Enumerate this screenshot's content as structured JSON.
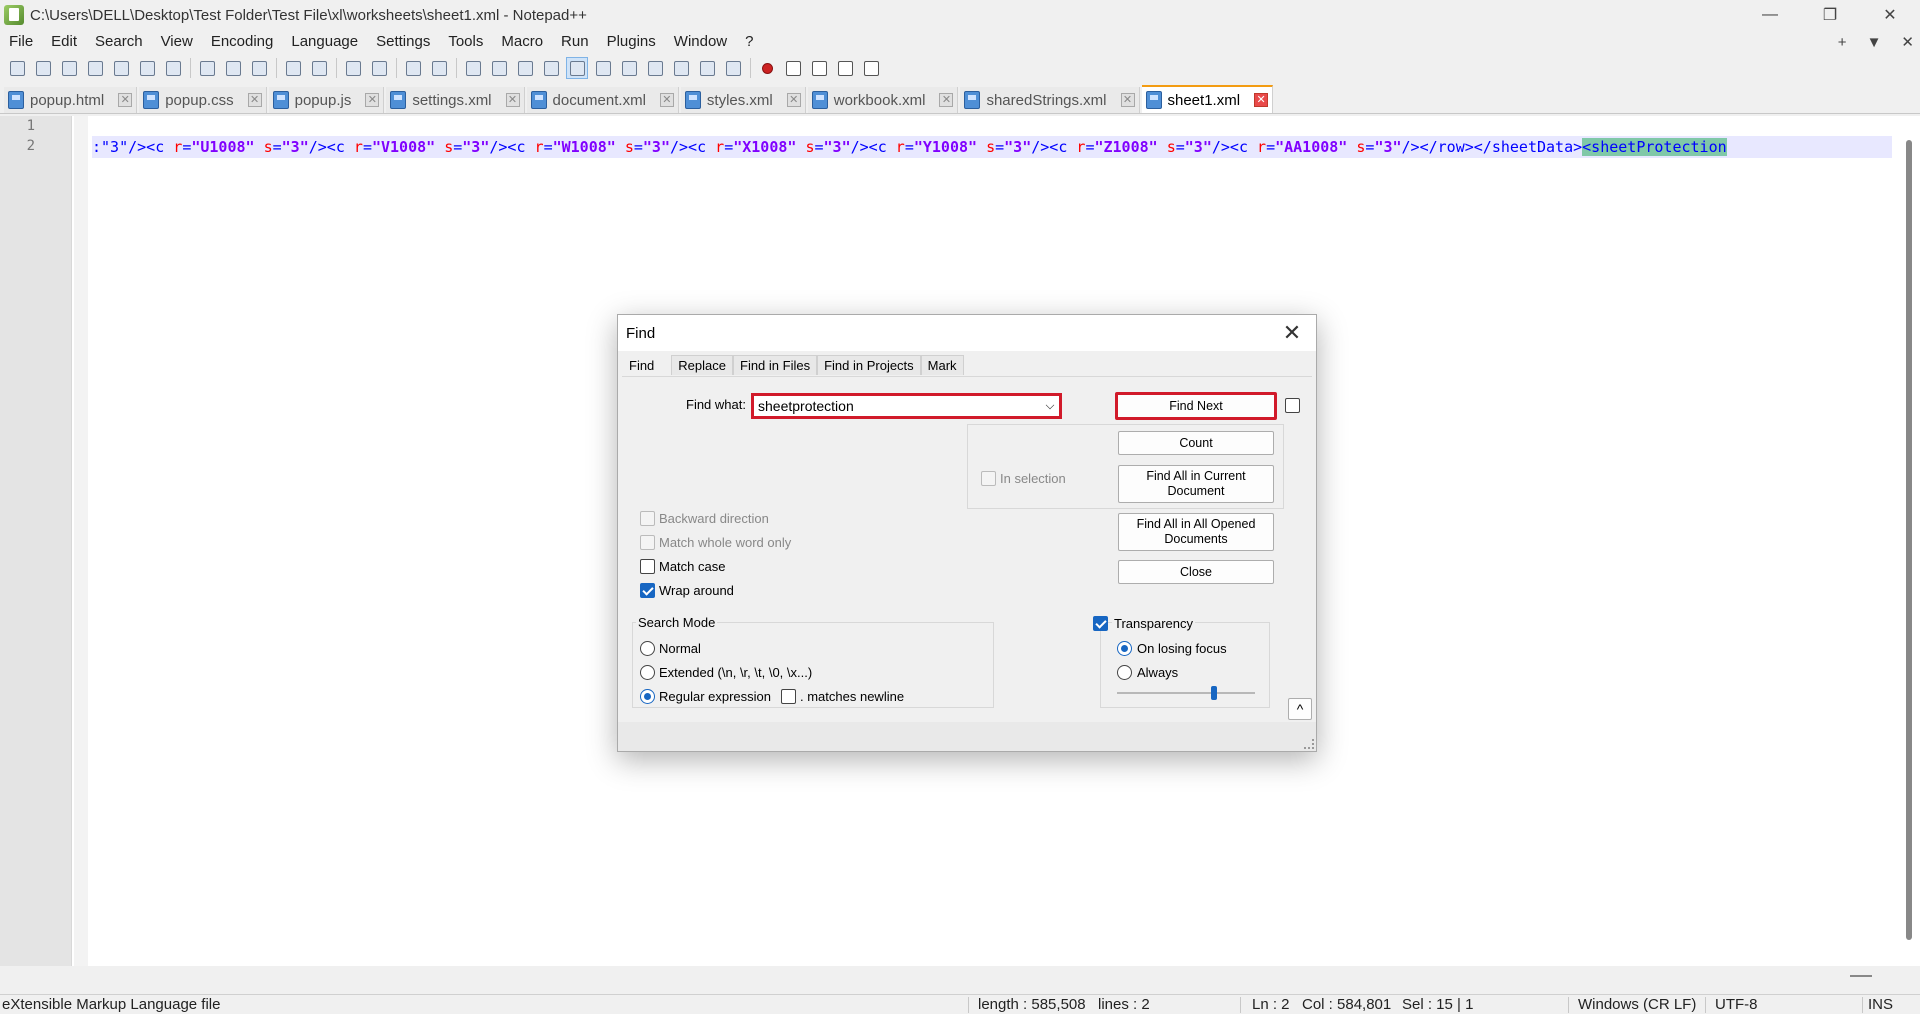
{
  "window": {
    "title": "C:\\Users\\DELL\\Desktop\\Test Folder\\Test File\\xl\\worksheets\\sheet1.xml - Notepad++",
    "controls": {
      "minimize": "—",
      "restore": "❐",
      "close": "✕"
    }
  },
  "menu": [
    "File",
    "Edit",
    "Search",
    "View",
    "Encoding",
    "Language",
    "Settings",
    "Tools",
    "Macro",
    "Run",
    "Plugins",
    "Window",
    "?"
  ],
  "menu_right": {
    "add": "+",
    "list": "▼",
    "close": "✕"
  },
  "tabs": [
    {
      "label": "popup.html"
    },
    {
      "label": "popup.css"
    },
    {
      "label": "popup.js"
    },
    {
      "label": "settings.xml"
    },
    {
      "label": "document.xml"
    },
    {
      "label": "styles.xml"
    },
    {
      "label": "workbook.xml"
    },
    {
      "label": "sharedStrings.xml"
    },
    {
      "label": "sheet1.xml",
      "active": true
    }
  ],
  "tab_close_glyph": "✕",
  "editor": {
    "line_numbers": [
      "1",
      "2"
    ],
    "code_parts": [
      {
        "cls": "t",
        "text": ":\"3\"/><c "
      },
      {
        "cls": "a",
        "text": "r"
      },
      {
        "cls": "t",
        "text": "="
      },
      {
        "cls": "v",
        "text": "\"U1008\""
      },
      {
        "cls": "a",
        "text": " s"
      },
      {
        "cls": "t",
        "text": "="
      },
      {
        "cls": "v",
        "text": "\"3\""
      },
      {
        "cls": "t",
        "text": "/><c "
      },
      {
        "cls": "a",
        "text": "r"
      },
      {
        "cls": "t",
        "text": "="
      },
      {
        "cls": "v",
        "text": "\"V1008\""
      },
      {
        "cls": "a",
        "text": " s"
      },
      {
        "cls": "t",
        "text": "="
      },
      {
        "cls": "v",
        "text": "\"3\""
      },
      {
        "cls": "t",
        "text": "/><c "
      },
      {
        "cls": "a",
        "text": "r"
      },
      {
        "cls": "t",
        "text": "="
      },
      {
        "cls": "v",
        "text": "\"W1008\""
      },
      {
        "cls": "a",
        "text": " s"
      },
      {
        "cls": "t",
        "text": "="
      },
      {
        "cls": "v",
        "text": "\"3\""
      },
      {
        "cls": "t",
        "text": "/><c "
      },
      {
        "cls": "a",
        "text": "r"
      },
      {
        "cls": "t",
        "text": "="
      },
      {
        "cls": "v",
        "text": "\"X1008\""
      },
      {
        "cls": "a",
        "text": " s"
      },
      {
        "cls": "t",
        "text": "="
      },
      {
        "cls": "v",
        "text": "\"3\""
      },
      {
        "cls": "t",
        "text": "/><c "
      },
      {
        "cls": "a",
        "text": "r"
      },
      {
        "cls": "t",
        "text": "="
      },
      {
        "cls": "v",
        "text": "\"Y1008\""
      },
      {
        "cls": "a",
        "text": " s"
      },
      {
        "cls": "t",
        "text": "="
      },
      {
        "cls": "v",
        "text": "\"3\""
      },
      {
        "cls": "t",
        "text": "/><c "
      },
      {
        "cls": "a",
        "text": "r"
      },
      {
        "cls": "t",
        "text": "="
      },
      {
        "cls": "v",
        "text": "\"Z1008\""
      },
      {
        "cls": "a",
        "text": " s"
      },
      {
        "cls": "t",
        "text": "="
      },
      {
        "cls": "v",
        "text": "\"3\""
      },
      {
        "cls": "t",
        "text": "/><c "
      },
      {
        "cls": "a",
        "text": "r"
      },
      {
        "cls": "t",
        "text": "="
      },
      {
        "cls": "v",
        "text": "\"AA1008\""
      },
      {
        "cls": "a",
        "text": " s"
      },
      {
        "cls": "t",
        "text": "="
      },
      {
        "cls": "v",
        "text": "\"3\""
      },
      {
        "cls": "t",
        "text": "/></row></sheetData>"
      },
      {
        "cls": "sel",
        "text": "<sheetProtection"
      }
    ]
  },
  "dialog": {
    "title": "Find",
    "close_glyph": "✕",
    "tabs": [
      "Find",
      "Replace",
      "Find in Files",
      "Find in Projects",
      "Mark"
    ],
    "find_what_label": "Find what:",
    "find_what_value": "sheetprotection",
    "buttons": {
      "find_next": "Find Next",
      "count": "Count",
      "find_all_current_1": "Find All in Current",
      "find_all_current_2": "Document",
      "find_all_opened_1": "Find All in All Opened",
      "find_all_opened_2": "Documents",
      "close": "Close",
      "collapse": "^"
    },
    "in_selection": "In selection",
    "options": {
      "backward": "Backward direction",
      "whole_word": "Match whole word only",
      "match_case": "Match case",
      "wrap_around": "Wrap around"
    },
    "search_mode": {
      "title": "Search Mode",
      "normal": "Normal",
      "extended": "Extended (\\n, \\r, \\t, \\0, \\x...)",
      "regex": "Regular expression",
      "matches_newline": ". matches newline",
      "selected": "regex"
    },
    "transparency": {
      "label": "Transparency",
      "on_losing_focus": "On losing focus",
      "always": "Always",
      "level": 0.7
    }
  },
  "status": {
    "file_type": "eXtensible Markup Language file",
    "length": "length : 585,508",
    "lines": "lines : 2",
    "ln": "Ln : 2",
    "col": "Col : 584,801",
    "sel": "Sel : 15 | 1",
    "eol": "Windows (CR LF)",
    "encoding": "UTF-8",
    "mode": "INS"
  }
}
